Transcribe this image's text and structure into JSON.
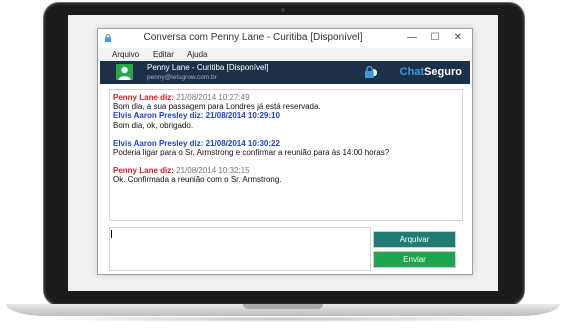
{
  "window": {
    "title": "Conversa com Penny Lane - Curitiba [Disponível]",
    "minimize_glyph": "—",
    "maximize_glyph": "☐",
    "close_glyph": "✕"
  },
  "menu": [
    "Arquivo",
    "Editar",
    "Ajuda"
  ],
  "contact": {
    "name": "Penny Lane - Curitiba [Disponível]",
    "email": "penny@letsgrow.com.br",
    "avatar_icon": "user-icon",
    "avatar_color": "#29a84a"
  },
  "brand": {
    "part1": "Chat",
    "part2": "Seguro",
    "icon": "lock-icon"
  },
  "messages": [
    {
      "sender": "Penny Lane diz:",
      "timestamp": "21/08/2014 10:27:49",
      "text": "Bom dia, a sua passagem para Londres já está reservada.",
      "color": "red"
    },
    {
      "sender": "Elvis Aaron Presley diz:",
      "timestamp": "21/08/2014 10:29:10",
      "text": "Bom dia, ok, obrigado.",
      "color": "blue"
    },
    {
      "sender": "Elvis Aaron Presley diz:",
      "timestamp": "21/08/2014 10:30:22",
      "text": "Poderia ligar para o Sr. Armstrong e confirmar a reunião para às 14:00 horas?",
      "color": "blue"
    },
    {
      "sender": "Penny Lane diz:",
      "timestamp": "21/08/2014 10:32:15",
      "text": "Ok. Confirmada a reunião com o Sr. Armstrong.",
      "color": "red"
    }
  ],
  "input": {
    "value": ""
  },
  "buttons": {
    "archive": "Arquivar",
    "send": "Enviar"
  },
  "colors": {
    "header_bg": "#1d3049",
    "archive_btn": "#1f7c74",
    "send_btn": "#1ea34f",
    "sender_red": "#d42020",
    "sender_blue": "#1f3fd1"
  }
}
